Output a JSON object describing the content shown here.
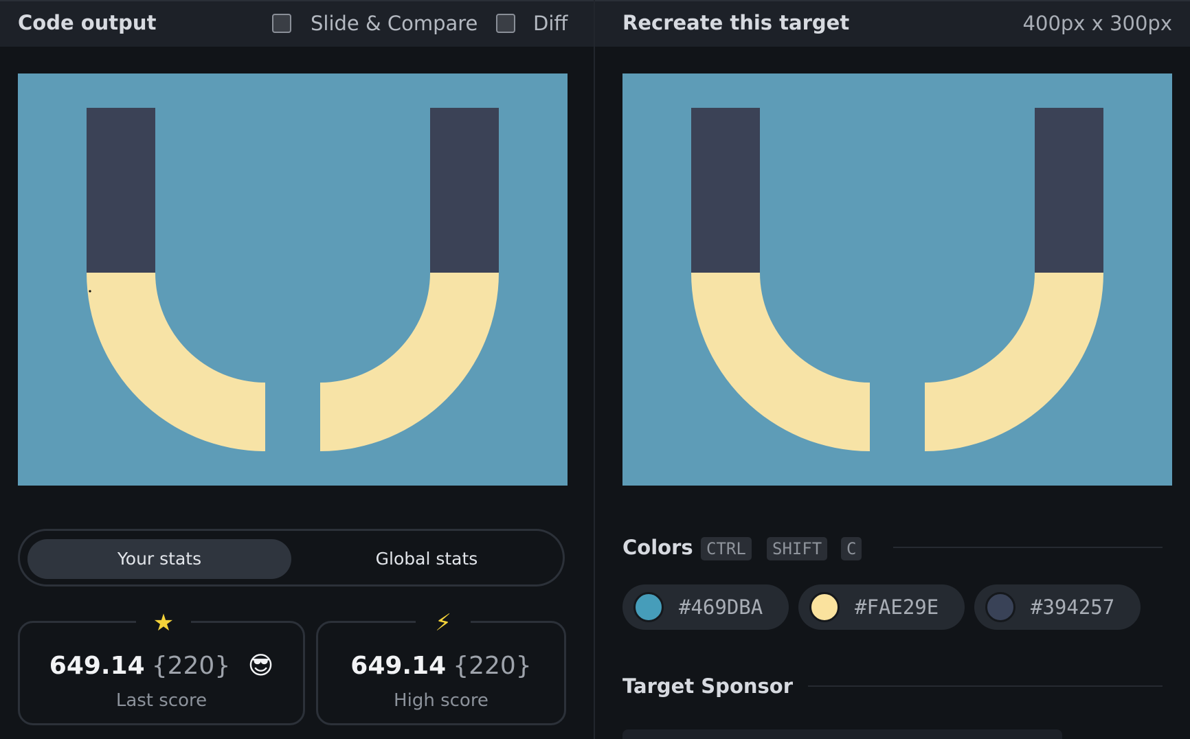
{
  "left": {
    "title": "Code output",
    "options": [
      {
        "label": "Slide & Compare",
        "checked": false
      },
      {
        "label": "Diff",
        "checked": false
      }
    ],
    "tabs": {
      "your_stats": "Your stats",
      "global_stats": "Global stats",
      "active": "your_stats"
    },
    "stats": [
      {
        "icon": "star-icon",
        "glyph": "★",
        "value": "649.14",
        "count": "{220}",
        "emoji": "😎",
        "label": "Last score"
      },
      {
        "icon": "lightning-icon",
        "glyph": "⚡",
        "value": "649.14",
        "count": "{220}",
        "label": "High score"
      }
    ]
  },
  "right": {
    "title": "Recreate this target",
    "dimensions": "400px x 300px",
    "colors_title": "Colors",
    "shortcut": [
      "CTRL",
      "SHIFT",
      "C"
    ],
    "colors": [
      "#469DBA",
      "#FAE29E",
      "#394257"
    ],
    "sponsor_title": "Target Sponsor"
  },
  "render_colors": {
    "background": "#5E9CB7",
    "arc": "#F7E3A6",
    "pillar": "#3B4256"
  }
}
